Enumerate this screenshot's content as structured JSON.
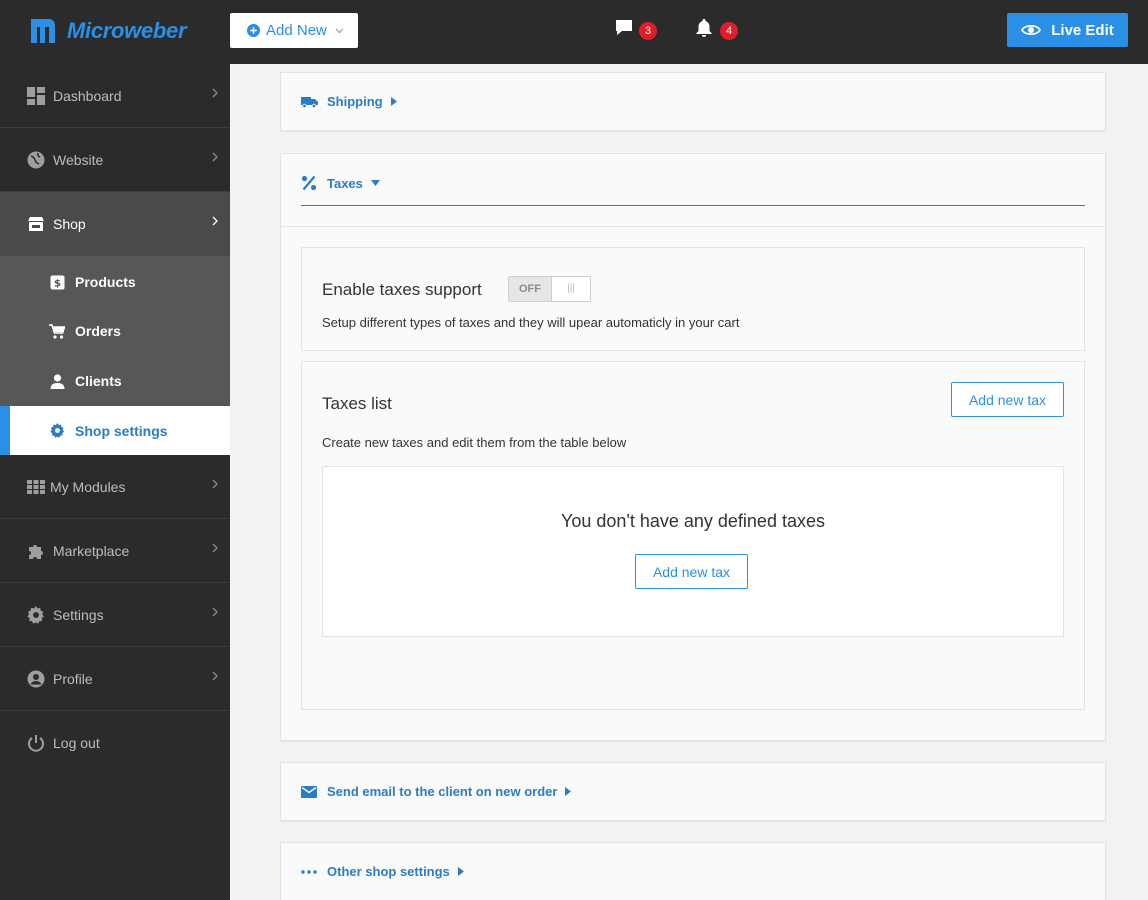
{
  "brand": {
    "name": "Microweber",
    "accent": "#2b8fe6"
  },
  "topbar": {
    "add_new_label": "Add New",
    "messages_count": "3",
    "notifications_count": "4",
    "live_edit_label": "Live Edit"
  },
  "sidebar": {
    "items": [
      {
        "label": "Dashboard",
        "icon": "dashboard-icon"
      },
      {
        "label": "Website",
        "icon": "globe-icon"
      },
      {
        "label": "Shop",
        "icon": "store-icon"
      }
    ],
    "shop_sub": [
      {
        "label": "Products",
        "icon": "product-tag-icon"
      },
      {
        "label": "Orders",
        "icon": "cart-icon"
      },
      {
        "label": "Clients",
        "icon": "user-icon"
      },
      {
        "label": "Shop settings",
        "icon": "gear-icon"
      }
    ],
    "items_after": [
      {
        "label": "My Modules",
        "icon": "grid-icon"
      },
      {
        "label": "Marketplace",
        "icon": "puzzle-icon"
      },
      {
        "label": "Settings",
        "icon": "gear-icon"
      },
      {
        "label": "Profile",
        "icon": "account-circle-icon"
      }
    ],
    "logout_label": "Log out"
  },
  "main": {
    "shipping_label": "Shipping",
    "taxes_label": "Taxes",
    "enable_taxes": {
      "title": "Enable taxes support",
      "toggle_state": "OFF",
      "description": "Setup different types of taxes and they will upear automaticly in your cart"
    },
    "taxes_list": {
      "title": "Taxes list",
      "add_button": "Add new tax",
      "description": "Create new taxes and edit them from the table below",
      "empty_message": "You don't have any defined taxes",
      "empty_add_button": "Add new tax"
    },
    "email_section_label": "Send email to the client on new order",
    "other_settings_label": "Other shop settings"
  }
}
